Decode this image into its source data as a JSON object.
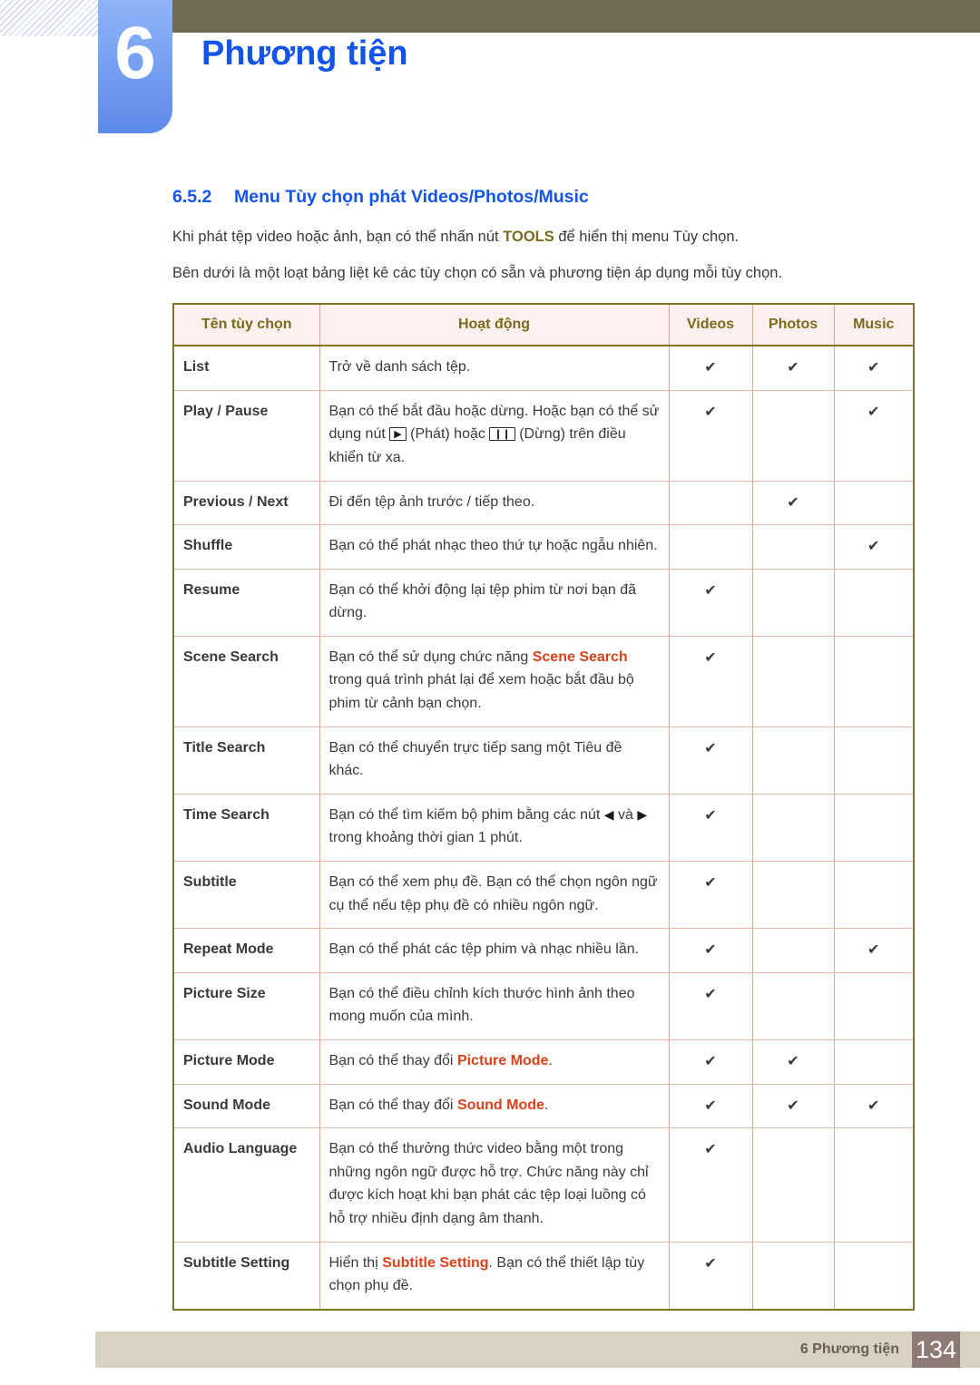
{
  "header": {
    "chapter_number": "6",
    "chapter_title": "Phương tiện"
  },
  "section": {
    "number": "6.5.2",
    "title": "Menu Tùy chọn phát Videos/Photos/Music"
  },
  "paragraphs": {
    "p1_before": "Khi phát tệp video hoặc ảnh, bạn có thể nhấn nút ",
    "p1_bold": "TOOLS",
    "p1_after": " để hiển thị menu Tùy chọn.",
    "p2": "Bên dưới là một loạt bảng liệt kê các tùy chọn có sẵn và phương tiện áp dụng mỗi tùy chọn."
  },
  "table": {
    "headers": {
      "name": "Tên tùy chọn",
      "action": "Hoạt động",
      "videos": "Videos",
      "photos": "Photos",
      "music": "Music"
    },
    "check_glyph": "✔",
    "rows": [
      {
        "name": "List",
        "name_parts": null,
        "desc": "Trở về danh sách tệp.",
        "videos": "✔",
        "photos": "✔",
        "music": "✔"
      },
      {
        "name": "Play / Pause",
        "name_parts": {
          "first": "Play",
          "sep": " / ",
          "second": "Pause"
        },
        "desc_1": "Bạn có thể bắt đầu hoặc dừng. Hoặc bạn có thể sử dụng nút ",
        "glyph_play": "▶",
        "desc_2": " (Phát) hoặc ",
        "glyph_pause": "❙❙",
        "desc_3": " (Dừng) trên điều khiển từ xa.",
        "videos": "✔",
        "photos": "",
        "music": "✔"
      },
      {
        "name": "Previous / Next",
        "name_parts": {
          "first": "Previous",
          "sep": " / ",
          "second": "Next"
        },
        "desc": "Đi đến tệp ảnh trước / tiếp theo.",
        "videos": "",
        "photos": "✔",
        "music": ""
      },
      {
        "name": "Shuffle",
        "desc": "Bạn có thể phát nhạc theo thứ tự hoặc ngẫu nhiên.",
        "videos": "",
        "photos": "",
        "music": "✔"
      },
      {
        "name": "Resume",
        "desc": "Bạn có thể khởi động lại tệp phim từ nơi bạn đã dừng.",
        "videos": "✔",
        "photos": "",
        "music": ""
      },
      {
        "name": "Scene Search",
        "desc_1": "Bạn có thể sử dụng chức năng ",
        "desc_bold": "Scene Search",
        "desc_2": " trong quá trình phát lại để xem hoặc bắt đầu bộ phim từ cảnh bạn chọn.",
        "videos": "✔",
        "photos": "",
        "music": ""
      },
      {
        "name": "Title Search",
        "desc": "Bạn có thể chuyển trực tiếp sang một Tiêu đề khác.",
        "videos": "✔",
        "photos": "",
        "music": ""
      },
      {
        "name": "Time Search",
        "desc_1": "Bạn có thể tìm kiếm bộ phim bằng các nút ",
        "glyph_left": "◀",
        "desc_2": " và ",
        "glyph_right": "▶",
        "desc_3": " trong khoảng thời gian 1 phút.",
        "videos": "✔",
        "photos": "",
        "music": ""
      },
      {
        "name": "Subtitle",
        "desc": "Bạn có thể xem phụ đề. Bạn có thể chọn ngôn ngữ cụ thể nếu tệp phụ đề có nhiều ngôn ngữ.",
        "videos": "✔",
        "photos": "",
        "music": ""
      },
      {
        "name": "Repeat Mode",
        "desc": "Bạn có thể phát các tệp phim và nhạc nhiều lần.",
        "videos": "✔",
        "photos": "",
        "music": "✔"
      },
      {
        "name": "Picture Size",
        "desc": "Bạn có thể điều chỉnh kích thước hình ảnh theo mong muốn của mình.",
        "videos": "✔",
        "photos": "",
        "music": ""
      },
      {
        "name": "Picture Mode",
        "desc_1": "Bạn có thể thay đổi ",
        "desc_bold": "Picture Mode",
        "desc_2": ".",
        "videos": "✔",
        "photos": "✔",
        "music": ""
      },
      {
        "name": "Sound Mode",
        "desc_1": "Bạn có thể thay đổi ",
        "desc_bold": "Sound Mode",
        "desc_2": ".",
        "videos": "✔",
        "photos": "✔",
        "music": "✔"
      },
      {
        "name": "Audio Language",
        "desc": "Bạn có thể thưởng thức video bằng một trong những ngôn ngữ được hỗ trợ. Chức năng này chỉ được kích hoạt khi bạn phát các tệp loại luồng có hỗ trợ nhiều định dạng âm thanh.",
        "videos": "✔",
        "photos": "",
        "music": ""
      },
      {
        "name": "Subtitle Setting",
        "desc_1": "Hiển thị ",
        "desc_bold": "Subtitle Setting",
        "desc_2": ". Bạn có thể thiết lập tùy chọn phụ đề.",
        "videos": "✔",
        "photos": "",
        "music": ""
      }
    ]
  },
  "footer": {
    "label": "6 Phương tiện",
    "page_number": "134"
  },
  "colors": {
    "accent_blue": "#1454e8",
    "olive": "#6f6b53",
    "table_border": "#837424",
    "row_border": "#efb9a5",
    "header_bg": "#fdf1ef",
    "option_name": "#d8421c",
    "footer_bar": "#d8d3c1",
    "footer_page_bg": "#8d7a75"
  }
}
